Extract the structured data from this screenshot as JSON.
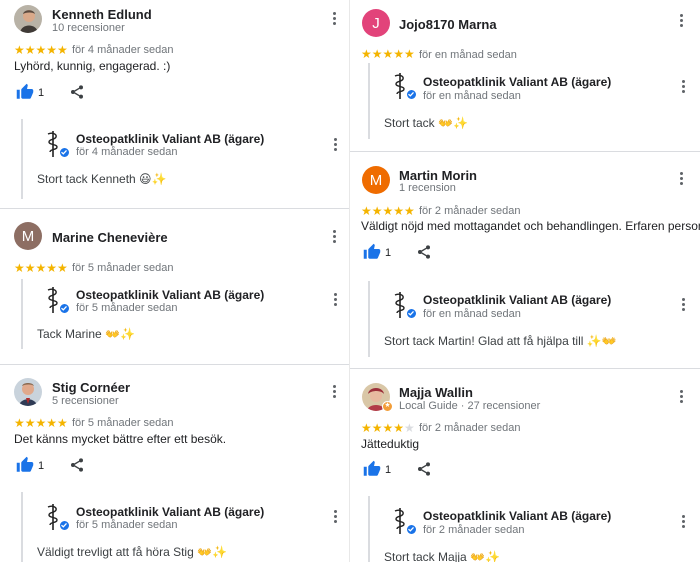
{
  "colors": {
    "star": "#f4b400",
    "star_off": "#dadce0",
    "accent_blue": "#1a73e8",
    "avatar_j": "#e2437a",
    "avatar_m_brown": "#8d6e63",
    "avatar_m_orange": "#ef6c00",
    "local_guide_badge": "#f29d38"
  },
  "icons": {
    "more": "more-vert-icon",
    "like": "thumb-up-icon",
    "share": "share-icon",
    "owner_logo": "caduceus-logo",
    "verified": "verified-check-icon"
  },
  "reviews": [
    {
      "avatar_type": "photo",
      "name": "Kenneth Edlund",
      "meta": "10 recensioner",
      "rating": 5,
      "stars": "★★★★★",
      "time": "för 4 månader sedan",
      "text": "Lyhörd, kunnig, engagerad. :)",
      "likes": "1",
      "reply": {
        "owner": "Osteopatklinik Valiant AB (ägare)",
        "time": "för 4 månader sedan",
        "text": "Stort tack Kenneth 😃✨"
      }
    },
    {
      "avatar_type": "letter",
      "avatar_letter": "M",
      "name": "Marine Chenevière",
      "rating": 5,
      "stars": "★★★★★",
      "time": "för 5 månader sedan",
      "reply": {
        "owner": "Osteopatklinik Valiant AB (ägare)",
        "time": "för 5 månader sedan",
        "text": "Tack Marine 👐✨"
      }
    },
    {
      "avatar_type": "photo",
      "name": "Stig Cornéer",
      "meta": "5 recensioner",
      "rating": 5,
      "stars": "★★★★★",
      "time": "för 5 månader sedan",
      "text": "Det känns mycket bättre efter ett besök.",
      "likes": "1",
      "reply": {
        "owner": "Osteopatklinik Valiant AB (ägare)",
        "time": "för 5 månader sedan",
        "text": "Väldigt trevligt att få höra Stig 👐✨"
      }
    },
    {
      "avatar_type": "letter",
      "avatar_letter": "J",
      "name": "Jojo8170 Marna",
      "rating": 5,
      "stars": "★★★★★",
      "time": "för en månad sedan",
      "reply": {
        "owner": "Osteopatklinik Valiant AB (ägare)",
        "time": "för en månad sedan",
        "text": "Stort tack 👐✨"
      }
    },
    {
      "avatar_type": "letter",
      "avatar_letter": "M",
      "name": "Martin Morin",
      "meta": "1 recension",
      "rating": 5,
      "stars": "★★★★★",
      "time": "för 2 månader sedan",
      "text": "Väldigt nöjd med mottagandet och behandlingen. Erfaren personal",
      "likes": "1",
      "reply": {
        "owner": "Osteopatklinik Valiant AB (ägare)",
        "time": "för en månad sedan",
        "text": "Stort tack Martin! Glad att få hjälpa till ✨👐"
      }
    },
    {
      "avatar_type": "photo",
      "name": "Majja Wallin",
      "meta": "Local Guide · 27 recensioner",
      "rating": 4,
      "stars_on": "★★★★",
      "stars_off": "★",
      "time": "för 2 månader sedan",
      "text": "Jätteduktig",
      "likes": "1",
      "reply": {
        "owner": "Osteopatklinik Valiant AB (ägare)",
        "time": "för 2 månader sedan",
        "text": "Stort tack Majja 👐✨"
      }
    }
  ]
}
